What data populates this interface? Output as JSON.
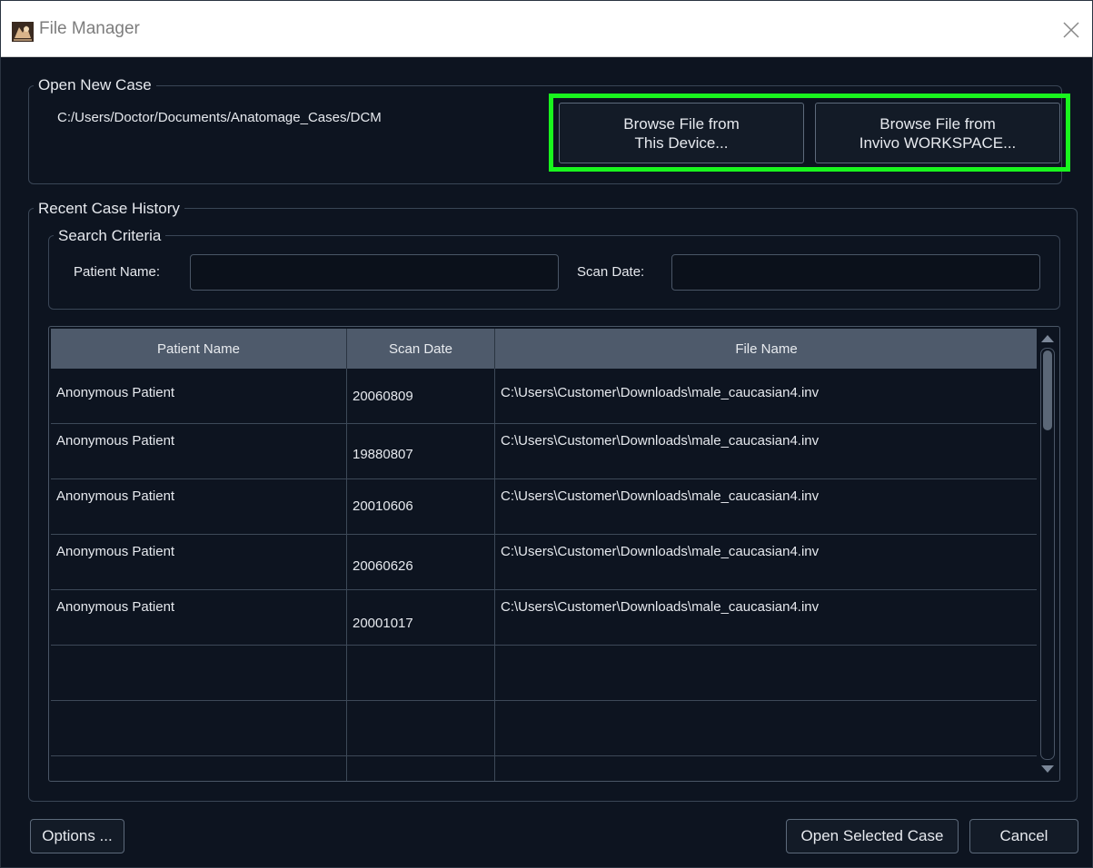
{
  "window": {
    "title": "File Manager",
    "app_icon": "anatomage-app-icon",
    "close_icon": "close-icon"
  },
  "open_new_case": {
    "group_title": "Open New Case",
    "path": "C:/Users/Doctor/Documents/Anatomage_Cases/DCM",
    "browse_device_line1": "Browse File from",
    "browse_device_line2": "This Device...",
    "browse_workspace_line1": "Browse File from",
    "browse_workspace_line2": "Invivo WORKSPACE...",
    "highlight_color": "#19f51e"
  },
  "recent_history": {
    "group_title": "Recent Case History",
    "search_criteria_title": "Search Criteria",
    "patient_name_label": "Patient Name:",
    "patient_name_value": "",
    "scan_date_label": "Scan Date:",
    "scan_date_value": ""
  },
  "table": {
    "columns": [
      "Patient Name",
      "Scan Date",
      "File Name"
    ],
    "rows": [
      {
        "patient": "Anonymous Patient",
        "date": "20060809",
        "file": "C:\\Users\\Customer\\Downloads\\male_caucasian4.inv"
      },
      {
        "patient": "Anonymous Patient",
        "date": "19880807",
        "file": "C:\\Users\\Customer\\Downloads\\male_caucasian4.inv"
      },
      {
        "patient": "Anonymous Patient",
        "date": "20010606",
        "file": "C:\\Users\\Customer\\Downloads\\male_caucasian4.inv"
      },
      {
        "patient": "Anonymous Patient",
        "date": "20060626",
        "file": "C:\\Users\\Customer\\Downloads\\male_caucasian4.inv"
      },
      {
        "patient": "Anonymous Patient",
        "date": "20001017",
        "file": "C:\\Users\\Customer\\Downloads\\male_caucasian4.inv"
      },
      {
        "patient": "",
        "date": "",
        "file": ""
      },
      {
        "patient": "",
        "date": "",
        "file": ""
      },
      {
        "patient": "",
        "date": "",
        "file": ""
      }
    ]
  },
  "footer": {
    "options_label": "Options ...",
    "open_selected_label": "Open Selected Case",
    "cancel_label": "Cancel"
  },
  "colors": {
    "background": "#0d1420",
    "header": "#4e5a6b",
    "border": "#3a4656"
  }
}
